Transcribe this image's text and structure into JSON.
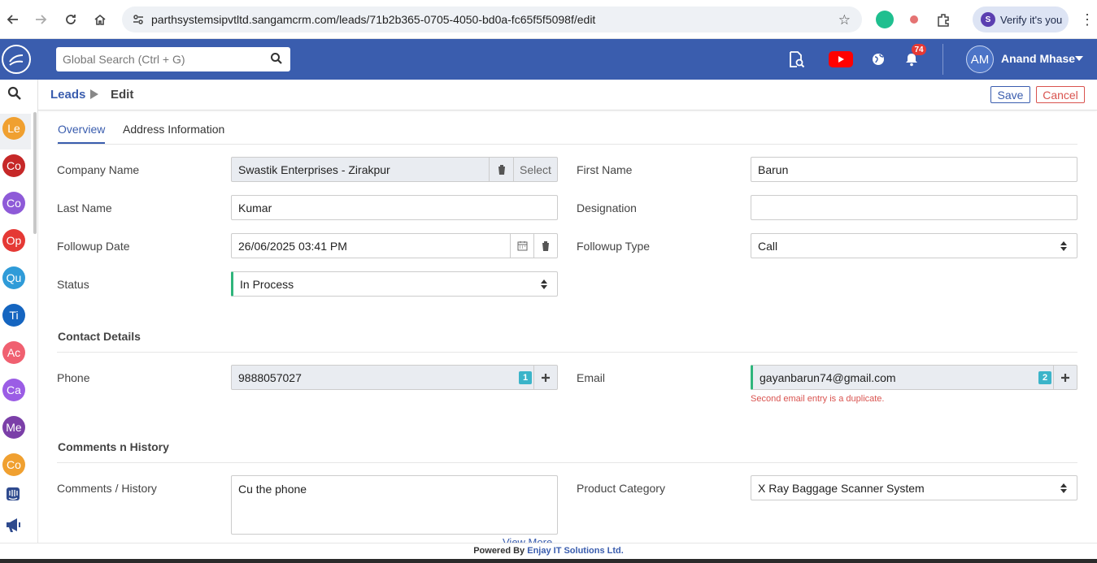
{
  "browser": {
    "url": "parthsystemsipvtltd.sangamcrm.com/leads/71b2b365-0705-4050-bd0a-fc65f5f5098f/edit",
    "verify_label": "Verify it's you",
    "profile_initial": "S"
  },
  "header": {
    "search_placeholder": "Global Search (Ctrl + G)",
    "notification_count": "74",
    "user_initials": "AM",
    "user_name": "Anand Mhase"
  },
  "sidebar": {
    "items": [
      {
        "label": "Le",
        "color": "#f0a030"
      },
      {
        "label": "Co",
        "color": "#c62828"
      },
      {
        "label": "Co",
        "color": "#8e5ad8"
      },
      {
        "label": "Op",
        "color": "#e53935"
      },
      {
        "label": "Qu",
        "color": "#2f9bd8"
      },
      {
        "label": "Ti",
        "color": "#1565c0"
      },
      {
        "label": "Ac",
        "color": "#f06070"
      },
      {
        "label": "Ca",
        "color": "#9b5de5"
      },
      {
        "label": "Me",
        "color": "#7b3fa8"
      },
      {
        "label": "Co",
        "color": "#f0a030"
      }
    ]
  },
  "breadcrumb": {
    "module": "Leads",
    "action": "Edit",
    "save_label": "Save",
    "cancel_label": "Cancel"
  },
  "tabs": [
    "Overview",
    "Address Information"
  ],
  "form": {
    "company_name": {
      "label": "Company Name",
      "value": "Swastik Enterprises - Zirakpur",
      "select_label": "Select"
    },
    "first_name": {
      "label": "First Name",
      "value": "Barun"
    },
    "last_name": {
      "label": "Last Name",
      "value": "Kumar"
    },
    "designation": {
      "label": "Designation",
      "value": ""
    },
    "followup_date": {
      "label": "Followup Date",
      "value": "26/06/2025 03:41 PM"
    },
    "followup_type": {
      "label": "Followup Type",
      "value": "Call"
    },
    "status": {
      "label": "Status",
      "value": "In Process"
    }
  },
  "contact": {
    "title": "Contact Details",
    "phone": {
      "label": "Phone",
      "value": "9888057027",
      "count": "1"
    },
    "email": {
      "label": "Email",
      "value": "gayanbarun74@gmail.com",
      "count": "2",
      "error": "Second email entry is a duplicate."
    }
  },
  "comments": {
    "title": "Comments n History",
    "history": {
      "label": "Comments / History",
      "value": "Cu the phone"
    },
    "view_more": "View More",
    "product_category": {
      "label": "Product Category",
      "value": "X Ray Baggage Scanner System"
    }
  },
  "footer": {
    "powered_by": "Powered By",
    "company": "Enjay IT Solutions Ltd."
  }
}
